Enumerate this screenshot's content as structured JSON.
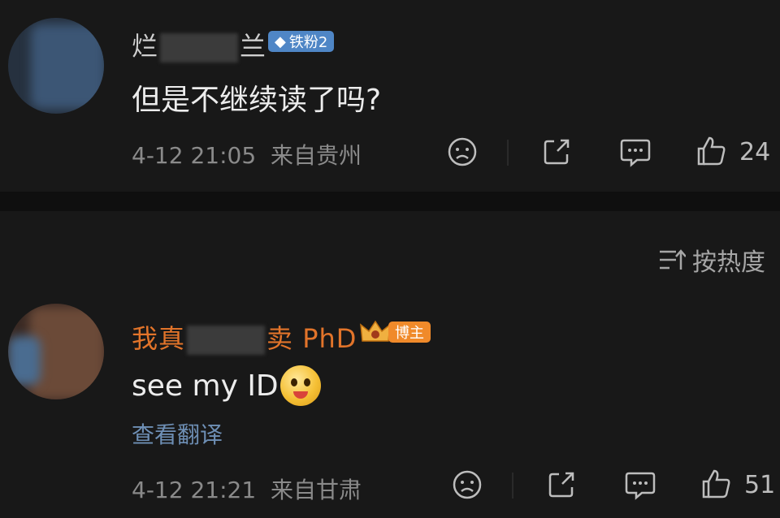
{
  "comment1": {
    "username_start": "烂",
    "username_end": "兰",
    "badge": "铁粉2",
    "text": "但是不继续读了吗?",
    "time": "4-12 21:05",
    "location": "来自贵州",
    "likes": "24"
  },
  "sort": {
    "label": "按热度"
  },
  "comment2": {
    "username_start": "我真",
    "username_end": "卖 PhD",
    "badge": "博主",
    "text": "see my ID",
    "translate": "查看翻译",
    "time": "4-12 21:21",
    "location": "来自甘肃",
    "likes": "51"
  },
  "colors": {
    "background": "#181818",
    "separator": "#0f0f0f",
    "fan_badge": "#4f86c6",
    "author_name": "#e2742a",
    "author_badge": "#f08a2a"
  },
  "icons": [
    "dislike-icon",
    "share-icon",
    "comment-icon",
    "like-icon",
    "sort-icon"
  ]
}
